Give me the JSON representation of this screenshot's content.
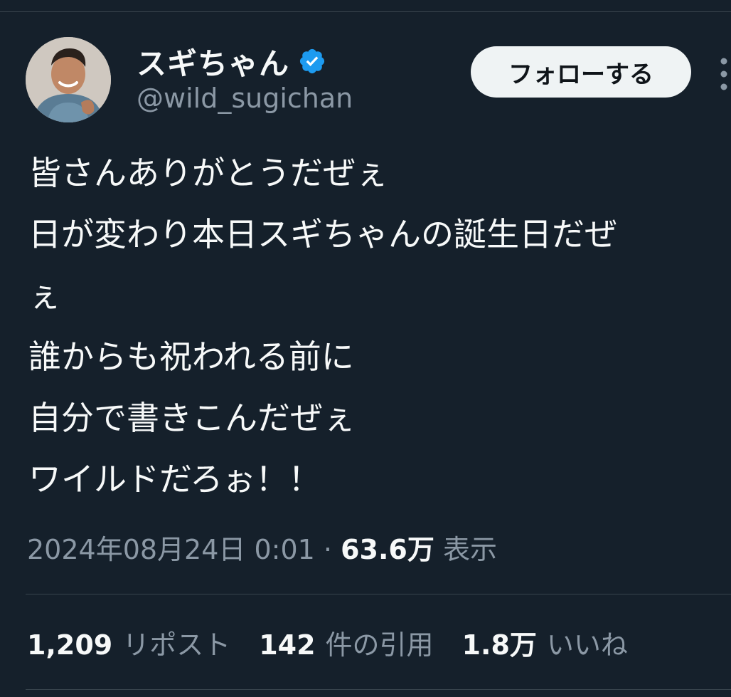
{
  "author": {
    "display_name": "スギちゃん",
    "handle": "@wild_sugichan",
    "verified_icon": "verified-badge-icon",
    "avatar_icon": "profile-avatar"
  },
  "actions": {
    "follow_label": "フォローする",
    "more_icon": "more-options-icon"
  },
  "tweet": {
    "lines": [
      "皆さんありがとうだぜぇ",
      "日が変わり本日スギちゃんの誕生日だぜ",
      "ぇ",
      "誰からも祝われる前に",
      "自分で書きこんだぜぇ",
      "ワイルドだろぉ！！"
    ]
  },
  "meta": {
    "timestamp": "2024年08月24日 0:01",
    "separator": "·",
    "views_count": "63.6万",
    "views_label": "表示"
  },
  "stats": {
    "reposts_count": "1,209",
    "reposts_label": "リポスト",
    "quotes_count": "142",
    "quotes_label": "件の引用",
    "likes_count": "1.8万",
    "likes_label": "いいね"
  },
  "colors": {
    "background": "#15202b",
    "text_primary": "#f7f9f9",
    "text_secondary": "#8b98a5",
    "divider": "#38444d",
    "verified": "#1d9bf0",
    "button_bg": "#eff3f4"
  }
}
